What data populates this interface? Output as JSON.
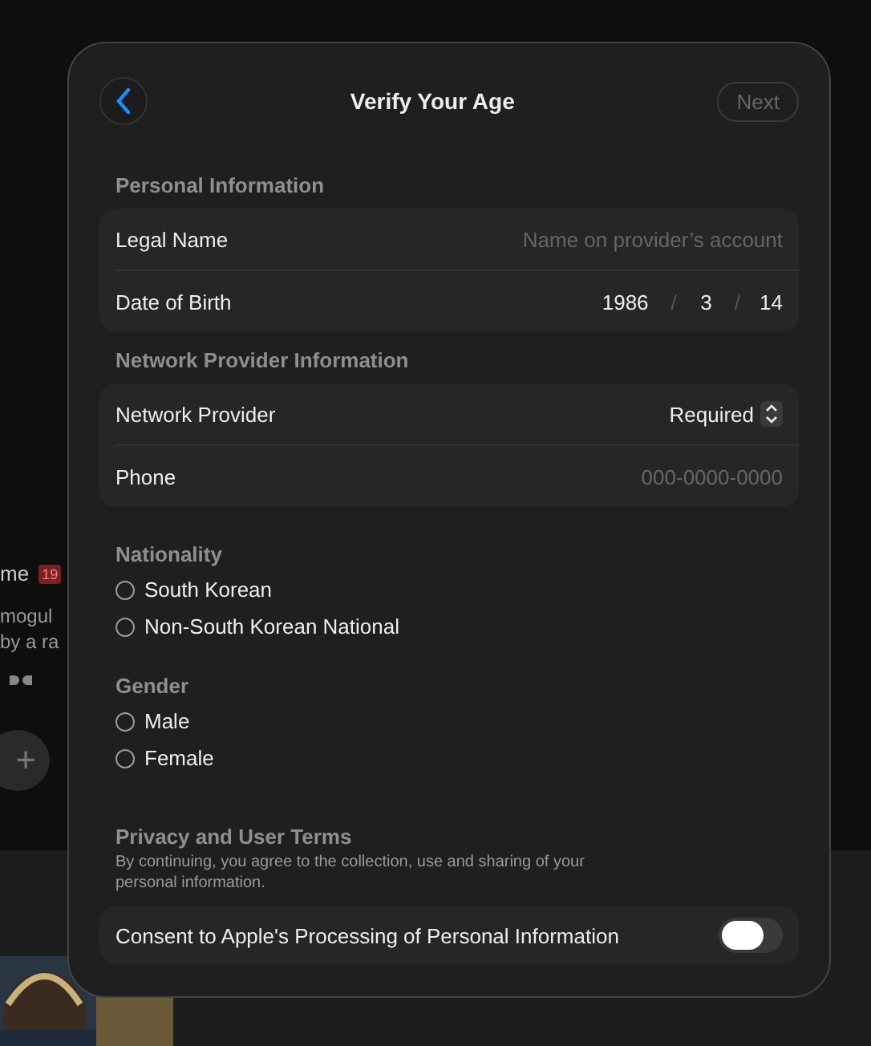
{
  "background": {
    "title_fragment": "me",
    "rating_badge": "19",
    "description_lines": [
      "mogul",
      "by a ra"
    ],
    "add_button": "+"
  },
  "dialog": {
    "title": "Verify Your Age",
    "next_button": {
      "label": "Next",
      "disabled": true
    },
    "personal": {
      "heading": "Personal Information",
      "legal_name": {
        "label": "Legal Name",
        "placeholder": "Name on provider’s account"
      },
      "birth": {
        "label": "Date of Birth",
        "year": "1986",
        "month": "3",
        "day": "14",
        "separator": "/"
      }
    },
    "network": {
      "heading": "Network Provider Information",
      "provider": {
        "label": "Network Provider",
        "value": "Required"
      },
      "phone": {
        "label": "Phone",
        "placeholder": "000-0000-0000"
      }
    },
    "nationality": {
      "heading": "Nationality",
      "options": [
        {
          "label": "South Korean",
          "selected": false
        },
        {
          "label": "Non-South Korean National",
          "selected": false
        }
      ]
    },
    "gender": {
      "heading": "Gender",
      "options": [
        {
          "label": "Male",
          "selected": false
        },
        {
          "label": "Female",
          "selected": false
        }
      ]
    },
    "privacy": {
      "heading": "Privacy and User Terms",
      "note": "By continuing, you agree to the collection, use and sharing of your personal information.",
      "consent": {
        "label": "Consent to Apple's Processing of Personal Information",
        "on": false
      }
    }
  }
}
